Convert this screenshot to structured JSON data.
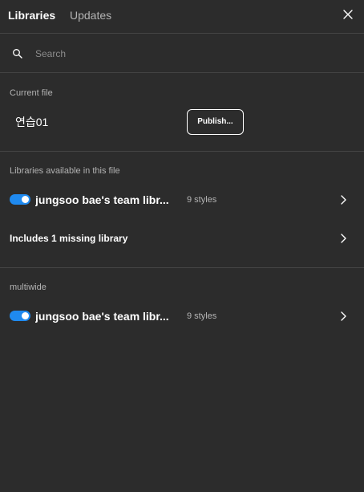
{
  "header": {
    "tabs": [
      {
        "label": "Libraries",
        "active": true
      },
      {
        "label": "Updates",
        "active": false
      }
    ],
    "close_icon": "close-icon"
  },
  "search": {
    "placeholder": "Search",
    "value": "",
    "icon": "search-icon"
  },
  "current_file": {
    "section_label": "Current file",
    "file_name": "연습01",
    "publish_label": "Publish..."
  },
  "available_libraries": {
    "section_label": "Libraries available in this file",
    "items": [
      {
        "name": "jungsoo bae's team libr...",
        "styles": "9 styles",
        "enabled": true
      }
    ],
    "missing_label": "Includes 1 missing library"
  },
  "multiwide": {
    "section_label": "multiwide",
    "items": [
      {
        "name": "jungsoo bae's team libr...",
        "styles": "9 styles",
        "enabled": true
      }
    ]
  },
  "colors": {
    "background": "#2c2c2c",
    "divider": "#444444",
    "accent": "#1f8af0",
    "text_primary": "#ffffff",
    "text_secondary": "#b3b3b3"
  }
}
